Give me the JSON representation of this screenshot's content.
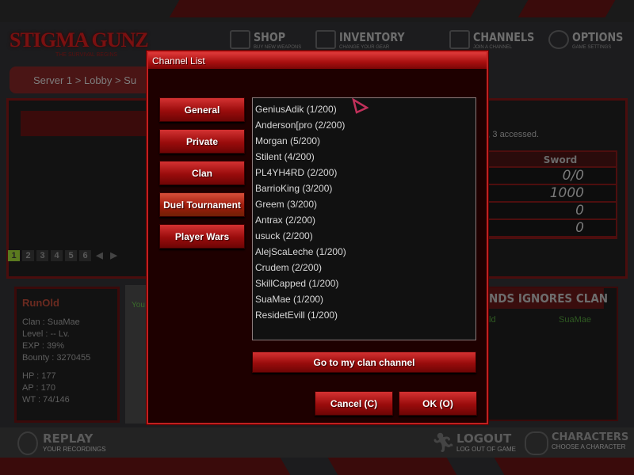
{
  "logo": {
    "text": "STIGMA GUNZ",
    "tagline": "THE SURVIVAL BEGINS"
  },
  "nav": [
    {
      "label": "SHOP",
      "sub": "BUY NEW WEAPONS",
      "icon": "cart-icon"
    },
    {
      "label": "INVENTORY",
      "sub": "CHANGE YOUR GEAR",
      "icon": "shirt-icon"
    },
    {
      "label": "CHANNELS",
      "sub": "JOIN A CHANNEL",
      "icon": "tv-icon"
    },
    {
      "label": "OPTIONS",
      "sub": "GAME SETTINGS",
      "icon": "gears-icon"
    }
  ],
  "breadcrumb": "Server 1 > Lobby > Su",
  "lobby": {
    "message": "ma, 3 accessed.",
    "stats_header": "Sword",
    "stats": [
      "0/0",
      "1000",
      "0",
      "0"
    ],
    "pages": [
      "1",
      "2",
      "3",
      "4",
      "5",
      "6"
    ]
  },
  "player": {
    "name": "RunOld",
    "clan": "Clan : SuaMae",
    "level": "Level : -- Lv.",
    "exp": "EXP : 39%",
    "bounty": "Bounty : 3270455",
    "hp": "HP : 177",
    "ap": "AP : 170",
    "wt": "WT : 74/146"
  },
  "chat": {
    "prefix": "You"
  },
  "friends": {
    "tabs": "NDS  IGNORES CLAN",
    "row_name": "ld",
    "row_clan": "SuaMae"
  },
  "bottom": [
    {
      "label": "REPLAY",
      "sub": "YOUR RECORDINGS"
    },
    {
      "label": "LOGOUT",
      "sub": "LOG OUT OF GAME"
    },
    {
      "label": "CHARACTERS",
      "sub": "CHOOSE A CHARACTER"
    }
  ],
  "dialog": {
    "title": "Channel List",
    "categories": [
      "General",
      "Private",
      "Clan",
      "Duel Tournament",
      "Player Wars"
    ],
    "selected_category": "Duel Tournament",
    "channels": [
      "GeniusAdik (1/200)",
      "Anderson[pro (2/200)",
      "Morgan (5/200)",
      "Stilent (4/200)",
      "PL4YH4RD (2/200)",
      "BarrioKing (3/200)",
      "Greem (3/200)",
      "Antrax (2/200)",
      "usuck (2/200)",
      "AlejScaLeche (1/200)",
      "Crudem (2/200)",
      "SkillCapped (1/200)",
      "SuaMae (1/200)",
      "ResidetEvill (1/200)"
    ],
    "clan_button": "Go to my clan channel",
    "cancel": "Cancel (C)",
    "ok": "OK (O)"
  },
  "colors": {
    "accent": "#c02020",
    "background": "#1c1c1e"
  }
}
